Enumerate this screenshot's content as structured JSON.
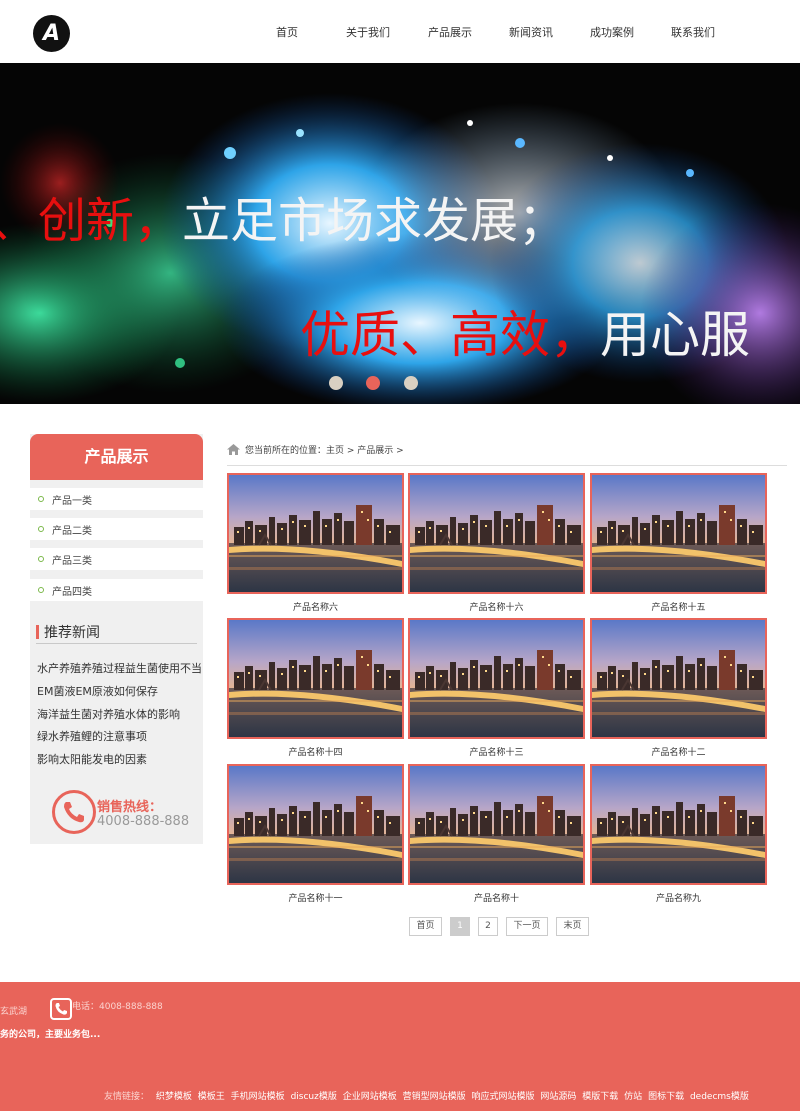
{
  "header": {
    "logo_letter": "A",
    "nav": [
      "首页",
      "关于我们",
      "产品展示",
      "新闻资讯",
      "成功案例",
      "联系我们"
    ]
  },
  "banner": {
    "line1_red": "、创新，",
    "line1_white": "立足市场求发展；",
    "line2_red": "优质、高效，",
    "line2_white": "用心服",
    "slides": 3,
    "active_slide": 2
  },
  "sidebar": {
    "title": "产品展示",
    "categories": [
      "产品一类",
      "产品二类",
      "产品三类",
      "产品四类"
    ],
    "news_title": "推荐新闻",
    "news": [
      "水产养殖养殖过程益生菌使用不当",
      "EM菌液EM原液如何保存",
      "海洋益生菌对养殖水体的影响",
      "绿水养殖鲤的注意事项",
      "影响太阳能发电的因素"
    ],
    "hotline_label": "销售热线：",
    "hotline_number": "4008-888-888"
  },
  "breadcrumb": {
    "text": "您当前所在的位置：主页 > 产品展示 >"
  },
  "products": [
    "产品名称六",
    "产品名称十六",
    "产品名称十五",
    "产品名称十四",
    "产品名称十三",
    "产品名称十二",
    "产品名称十一",
    "产品名称十",
    "产品名称九"
  ],
  "pagination": {
    "first": "首页",
    "pages": [
      "1",
      "2"
    ],
    "current": "1",
    "next": "下一页",
    "last": "末页"
  },
  "footer": {
    "address": "玄武湖",
    "tel": "电话：4008-888-888",
    "desc": "务的公司，主要业务包...",
    "links_label": "友情链接：",
    "links": [
      "织梦模板",
      "模板王",
      "手机网站模板",
      "discuz模版",
      "企业网站模板",
      "营销型网站模版",
      "响应式网站模版",
      "网站源码",
      "模版下载",
      "仿站",
      "图标下载",
      "dedecms模版"
    ]
  },
  "colors": {
    "accent": "#e8645a",
    "sidebar_bg": "#f0f0f0",
    "category_bullet": "#7bb84a"
  }
}
